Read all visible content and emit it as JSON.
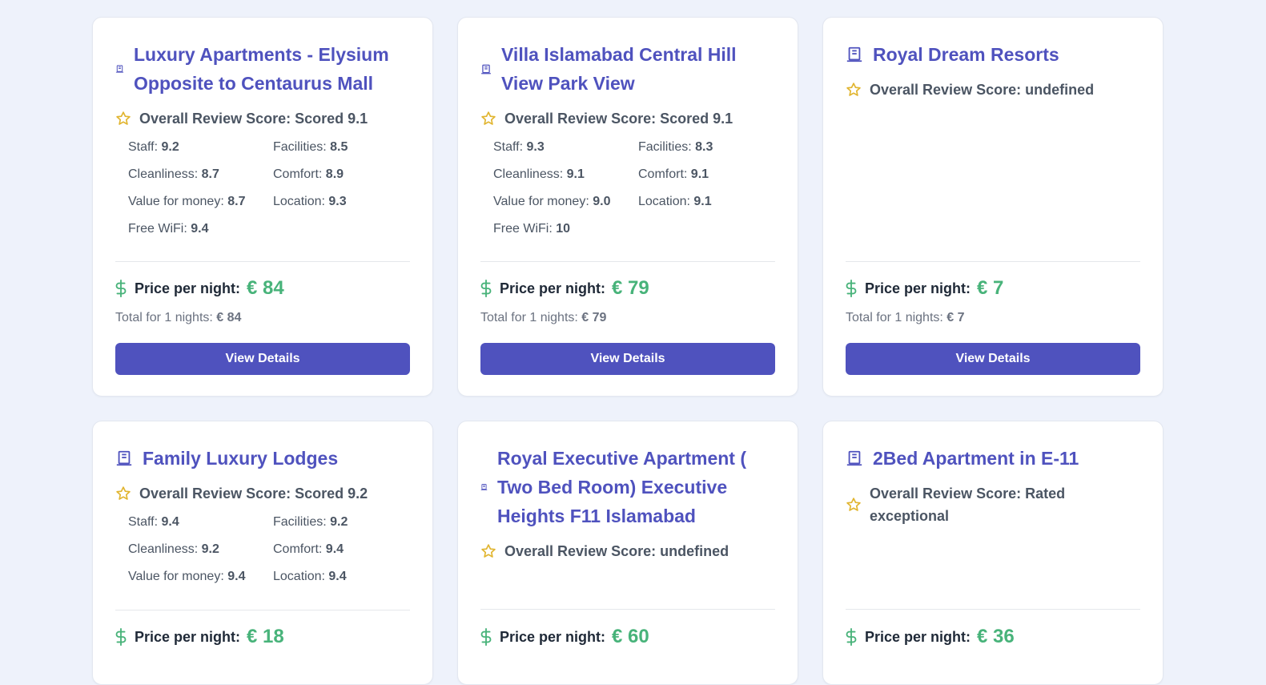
{
  "cards": [
    {
      "title": "Luxury Apartments - Elysium Opposite to Centaurus Mall",
      "score": "Overall Review Score: Scored 9.1",
      "sub": [
        {
          "label": "Staff:",
          "value": "9.2"
        },
        {
          "label": "Facilities:",
          "value": "8.5"
        },
        {
          "label": "Cleanliness:",
          "value": "8.7"
        },
        {
          "label": "Comfort:",
          "value": "8.9"
        },
        {
          "label": "Value for money:",
          "value": "8.7"
        },
        {
          "label": "Location:",
          "value": "9.3"
        },
        {
          "label": "Free WiFi:",
          "value": "9.4"
        }
      ],
      "price_label": "Price per night:",
      "price": "€ 84",
      "total_label": "Total for 1 nights:",
      "total": "€ 84",
      "button": "View Details"
    },
    {
      "title": "Villa Islamabad Central Hill View Park View",
      "score": "Overall Review Score: Scored 9.1",
      "sub": [
        {
          "label": "Staff:",
          "value": "9.3"
        },
        {
          "label": "Facilities:",
          "value": "8.3"
        },
        {
          "label": "Cleanliness:",
          "value": "9.1"
        },
        {
          "label": "Comfort:",
          "value": "9.1"
        },
        {
          "label": "Value for money:",
          "value": "9.0"
        },
        {
          "label": "Location:",
          "value": "9.1"
        },
        {
          "label": "Free WiFi:",
          "value": "10"
        }
      ],
      "price_label": "Price per night:",
      "price": "€ 79",
      "total_label": "Total for 1 nights:",
      "total": "€ 79",
      "button": "View Details"
    },
    {
      "title": "Royal Dream Resorts",
      "score": "Overall Review Score: undefined",
      "price_label": "Price per night:",
      "price": "€ 7",
      "total_label": "Total for 1 nights:",
      "total": "€ 7",
      "button": "View Details"
    },
    {
      "title": "Family Luxury Lodges",
      "score": "Overall Review Score: Scored 9.2",
      "sub": [
        {
          "label": "Staff:",
          "value": "9.4"
        },
        {
          "label": "Facilities:",
          "value": "9.2"
        },
        {
          "label": "Cleanliness:",
          "value": "9.2"
        },
        {
          "label": "Comfort:",
          "value": "9.4"
        },
        {
          "label": "Value for money:",
          "value": "9.4"
        },
        {
          "label": "Location:",
          "value": "9.4"
        }
      ],
      "price_label": "Price per night:",
      "price": "€ 18"
    },
    {
      "title": "Royal Executive Apartment ( Two Bed Room) Executive Heights F11 Islamabad",
      "score": "Overall Review Score: undefined",
      "price_label": "Price per night:",
      "price": "€ 60"
    },
    {
      "title": "2Bed Apartment in E-11",
      "score": "Overall Review Score: Rated exceptional",
      "price_label": "Price per night:",
      "price": "€ 36"
    }
  ],
  "colors": {
    "accent": "#4f52be",
    "price_green": "#48b37a",
    "star": "#e1b530",
    "background": "#eef2fb"
  },
  "icons": {
    "hotel": "hotel-icon",
    "star": "star-icon",
    "price": "dollar-icon"
  }
}
